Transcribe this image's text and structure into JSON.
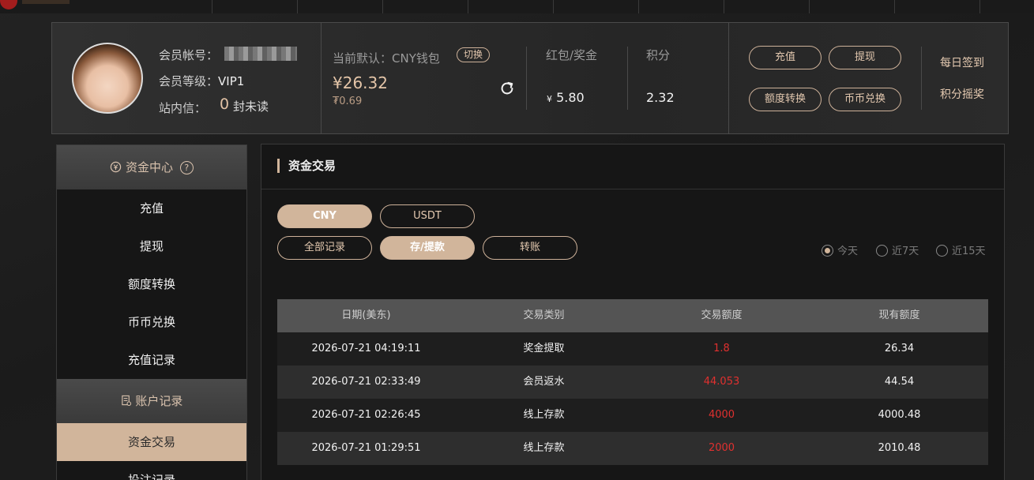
{
  "account": {
    "id_label": "会员帐号：",
    "level_label": "会员等级：",
    "level_value": "VIP1",
    "inbox_label": "站内信：",
    "inbox_count": "0",
    "inbox_suffix": "封未读"
  },
  "wallet": {
    "label": "当前默认：CNY钱包",
    "switch": "切换",
    "balance": "¥26.32",
    "sub_balance": "₮0.69"
  },
  "bonus": {
    "title": "红包/奖金",
    "currency": "¥",
    "value": "5.80"
  },
  "points": {
    "title": "积分",
    "value": "2.32"
  },
  "actions": {
    "deposit": "充值",
    "withdraw": "提现",
    "transfer": "额度转换",
    "exchange": "币币兑换",
    "daily_checkin": "每日签到",
    "points_lottery": "积分摇奖"
  },
  "sidebar": {
    "section1": "资金中心",
    "section1_help": "?",
    "items1": [
      "充值",
      "提现",
      "额度转换",
      "币币兑换",
      "充值记录"
    ],
    "section2": "账户记录",
    "items2": [
      "资金交易",
      "投注记录"
    ]
  },
  "main": {
    "title": "资金交易",
    "currency_tabs": [
      "CNY",
      "USDT"
    ],
    "type_tabs": [
      "全部记录",
      "存/提款",
      "转账"
    ],
    "range_options": [
      "今天",
      "近7天",
      "近15天"
    ],
    "table": {
      "headers": [
        "日期(美东)",
        "交易类别",
        "交易额度",
        "现有额度"
      ],
      "rows": [
        [
          "2026-07-21 04:19:11",
          "奖金提取",
          "1.8",
          "26.34"
        ],
        [
          "2026-07-21 02:33:49",
          "会员返水",
          "44.053",
          "44.54"
        ],
        [
          "2026-07-21 02:26:45",
          "线上存款",
          "4000",
          "4000.48"
        ],
        [
          "2026-07-21 01:29:51",
          "线上存款",
          "2000",
          "2010.48"
        ]
      ]
    }
  },
  "colors": {
    "accent": "#d1b59b",
    "negative_amount": "#e0302f",
    "background": "#1c1c1c"
  }
}
